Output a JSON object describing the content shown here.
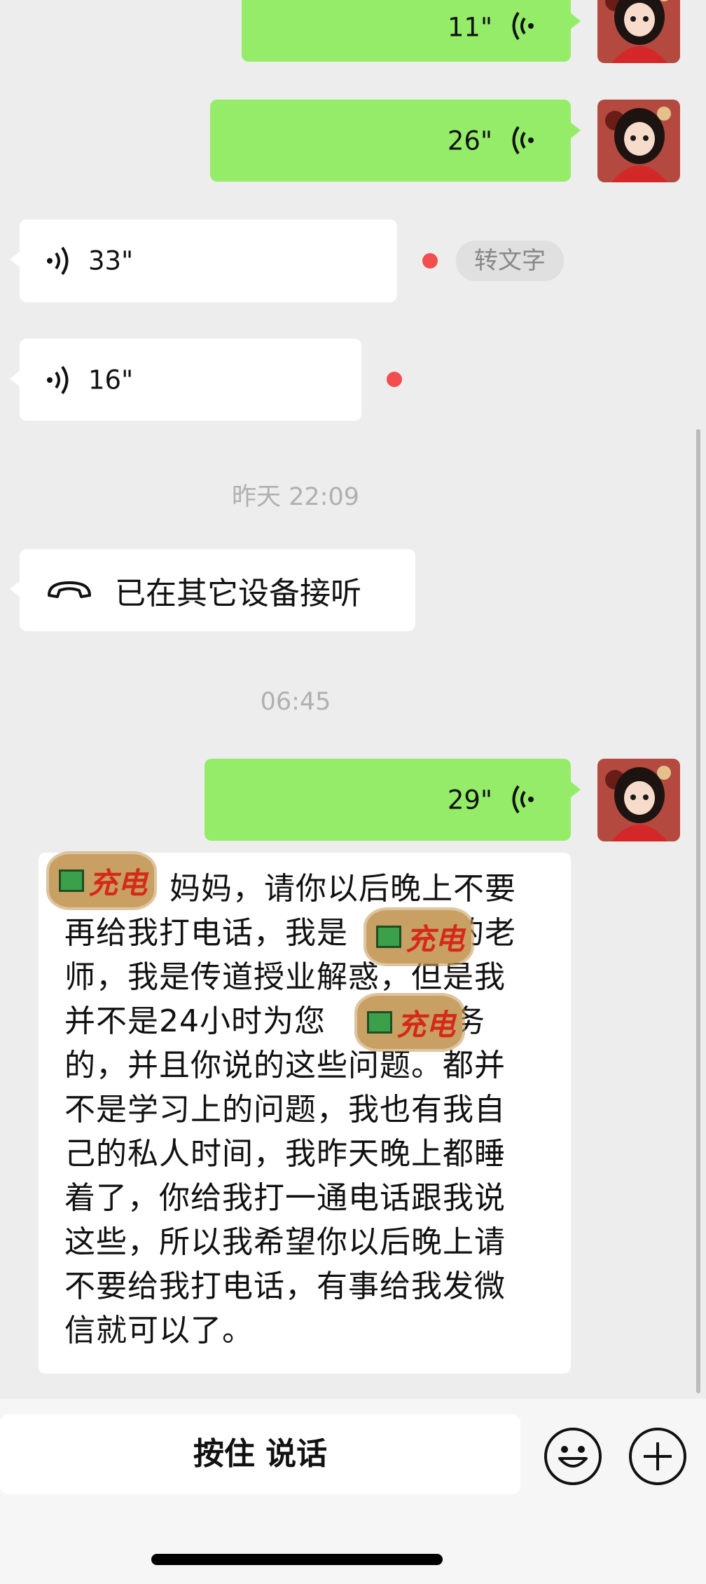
{
  "messages": {
    "sent_voice_1": {
      "duration": "11\""
    },
    "sent_voice_2": {
      "duration": "26\""
    },
    "recv_voice_1": {
      "duration": "33\"",
      "to_text_label": "转文字"
    },
    "recv_voice_2": {
      "duration": "16\""
    },
    "timestamp_1": "昨天 22:09",
    "call_notice": {
      "text": "已在其它设备接听"
    },
    "timestamp_2": "06:45",
    "sent_voice_3": {
      "duration": "29\""
    },
    "long_text": {
      "sticker_label": "充电",
      "lines": [
        "妈妈，请你以后晚上不要",
        "再给我打电话，我是",
        "的老",
        "师，我是传道授业解惑，但是我",
        "并不是24小时为您",
        "服务",
        "的，并且你说的这些问题。都并",
        "不是学习上的问题，我也有我自",
        "己的私人时间，我昨天晚上都睡",
        "着了，你给我打一通电话跟我说",
        "这些，所以我希望你以后晚上请",
        "不要给我打电话，有事给我发微",
        "信就可以了。"
      ]
    }
  },
  "input_bar": {
    "hold_to_talk_label": "按住 说话",
    "emoji_icon": "emoji-icon",
    "plus_icon": "plus-icon"
  },
  "colors": {
    "sent_bubble": "#95ec69",
    "received_bubble": "#ffffff",
    "background": "#ededed",
    "unread_dot": "#f24e4e"
  }
}
